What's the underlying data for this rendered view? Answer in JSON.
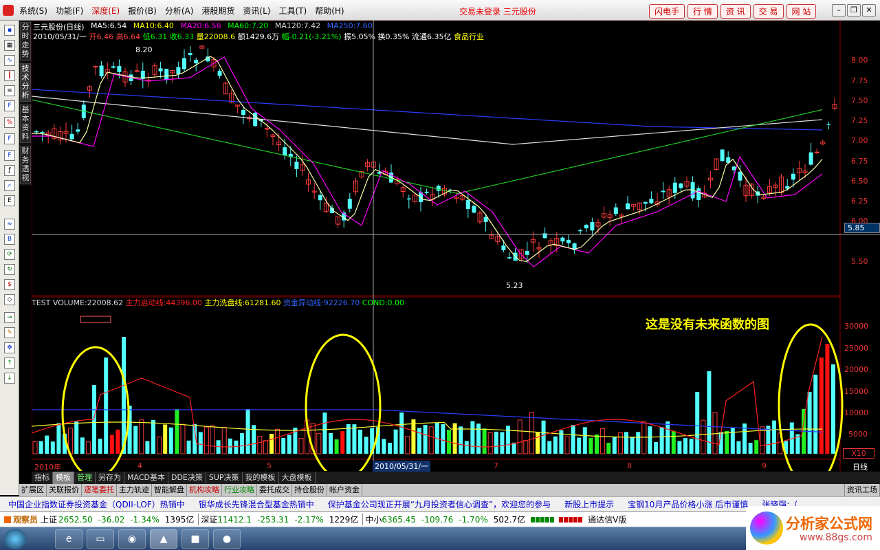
{
  "menu": [
    "系统(S)",
    "功能(F)",
    "深度(E)",
    "报价(B)",
    "分析(A)",
    "港股期货",
    "资讯(L)",
    "工具(T)",
    "帮助(H)"
  ],
  "status_msg": "交易未登录  三元股份",
  "top_buttons": [
    "闪电手",
    "行 情",
    "资 讯",
    "交 易",
    "网 站"
  ],
  "vertical_tabs": [
    "分时走势",
    "技术分析",
    "基本资料",
    "财务透视"
  ],
  "main_chart": {
    "title": "三元股份(日线)",
    "ma": [
      {
        "label": "MA5:6.54",
        "color": "#ffffff"
      },
      {
        "label": "MA10:6.40",
        "color": "#ffff00"
      },
      {
        "label": "MA20:6.56",
        "color": "#ff00ff"
      },
      {
        "label": "MA60:7.20",
        "color": "#00ff00"
      },
      {
        "label": "MA120:7.42",
        "color": "#dddddd"
      },
      {
        "label": "MA250:7.60",
        "color": "#3355ff"
      }
    ],
    "info_date": "2010/05/31/一",
    "info_open": "开6.46",
    "info_high": "高6.64",
    "info_low": "低6.31",
    "info_close": "收6.33",
    "info_vol": "量22008.6",
    "info_amt": "额1429.6万",
    "info_chg": "幅-0.21(-3.21%)",
    "info_amp": "振5.05%",
    "info_turn": "换0.35%",
    "info_float": "流通6.35亿",
    "info_ind": "食品行业",
    "high_label": "8.20",
    "low_label": "5.23",
    "crosshair_price": "5.85",
    "price_axis": [
      "8.00",
      "7.75",
      "7.50",
      "7.25",
      "7.00",
      "6.75",
      "6.50",
      "6.25",
      "6.00",
      "5.50"
    ]
  },
  "indicator": {
    "name": "TEST",
    "volume": "VOLUME:22008.62",
    "line1": "主力启动线:44396.00",
    "line2": "主力洗盘线:61281.60",
    "line3": "资金异动线:92226.70",
    "cond": "COND:0.00",
    "annotation": "这是没有未来函数的图",
    "axis": [
      "30000",
      "25000",
      "20000",
      "15000",
      "10000",
      "5000"
    ],
    "scale": "X10"
  },
  "time_axis": {
    "labels": [
      "2010年",
      "4",
      "5",
      "7",
      "8",
      "9"
    ],
    "cursor_date": "2010/05/31/一",
    "period": "日线"
  },
  "tabs1": [
    "指标",
    "模板",
    "管理",
    "另存为",
    "MACD基本",
    "DDE决策",
    "SUP决策",
    "我的模板",
    "大盘模板"
  ],
  "tabs2": [
    "扩展区",
    "关联报价",
    "逐笔委托",
    "主力轨迹",
    "智能解盘",
    "机构攻略",
    "行业攻略",
    "委托成交",
    "持仓股份",
    "帐户资金"
  ],
  "tabs2_right": "资讯工场",
  "news": [
    "中国企业指数证券投资基金（QDII-LOF）热销中",
    "银华成长先锋混合型基金热销中",
    "保护基金公司现正开展“九月投资者信心调查”，欢迎您的参与",
    "新股上市提示",
    "宝钢10月产品价格小涨  后市谨慎",
    "张晓强:（"
  ],
  "index_bar": {
    "watcher": "观察员",
    "sh_label": "上证",
    "sh_value": "2652.50",
    "sh_chg": "-36.02",
    "sh_pct": "-1.34%",
    "sh_amt": "1395亿",
    "sz_label": "深证",
    "sz_value": "11412.1",
    "sz_chg": "-253.31",
    "sz_pct": "-2.17%",
    "sz_amt": "1229亿",
    "zx_label": "中小",
    "zx_value": "6365.45",
    "zx_chg": "-109.76",
    "zx_pct": "-1.70%",
    "zx_amt": "502.7亿",
    "tdx": "通达信V版"
  },
  "logo": {
    "title": "分析家公式网",
    "url": "www.88gs.com"
  }
}
